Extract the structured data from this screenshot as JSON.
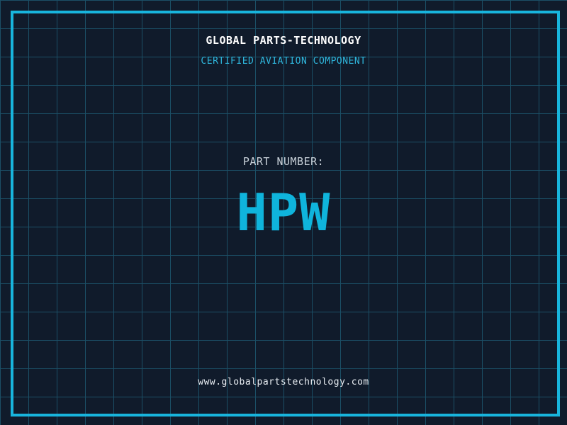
{
  "theme": {
    "background": "#101b2b",
    "grid_line": "#1b4f66",
    "frame": "#18b5dd",
    "title_color": "#ffffff",
    "subtitle_color": "#2fb7dd",
    "label_color": "#c9d2da",
    "part_color": "#0fb4dc",
    "url_color": "#e9eef3"
  },
  "header": {
    "title": "GLOBAL PARTS-TECHNOLOGY",
    "subtitle": "CERTIFIED AVIATION COMPONENT"
  },
  "part": {
    "label": "PART NUMBER:",
    "number": "HPW"
  },
  "footer": {
    "url": "www.globalpartstechnology.com"
  }
}
